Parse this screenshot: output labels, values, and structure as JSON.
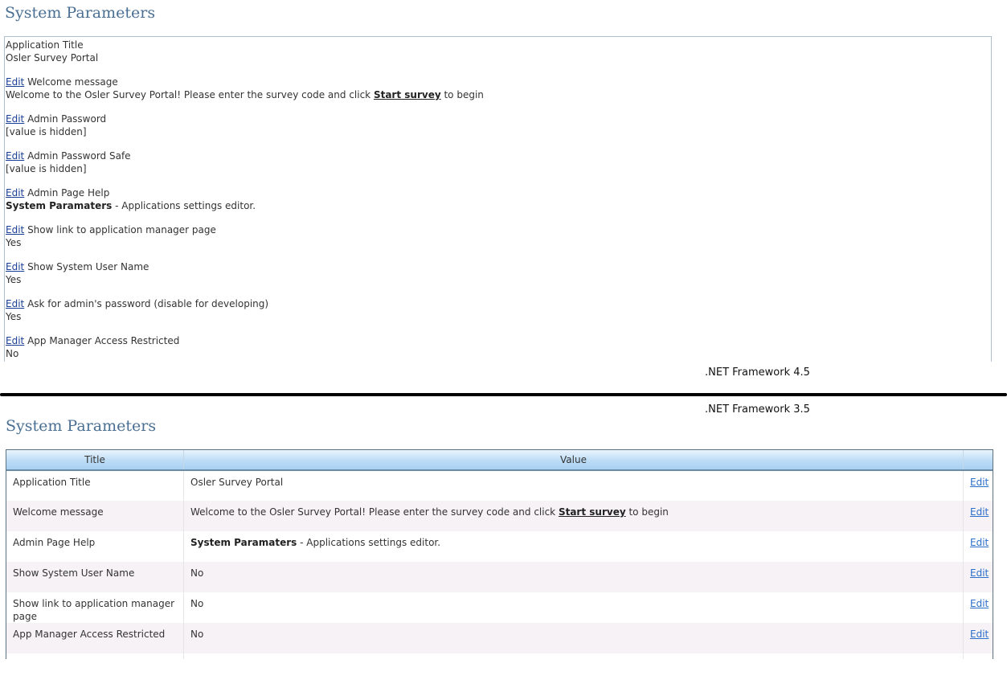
{
  "top": {
    "title": "System Parameters",
    "params": [
      {
        "edit": "",
        "name": "Application Title",
        "value": "Osler Survey Portal"
      },
      {
        "edit": "Edit",
        "name": " Welcome message",
        "value_pre": "Welcome to the Osler Survey Portal! Please enter the survey code and click ",
        "value_link": "Start survey",
        "value_post": " to begin"
      },
      {
        "edit": "Edit",
        "name": " Admin Password",
        "value": "[value is hidden]"
      },
      {
        "edit": "Edit",
        "name": " Admin Password Safe",
        "value": "[value is hidden]"
      },
      {
        "edit": "Edit",
        "name": " Admin Page Help",
        "value_bold": "System Paramaters",
        "value_rest": " - Applications settings editor."
      },
      {
        "edit": "Edit",
        "name": " Show link to application manager page",
        "value": "Yes"
      },
      {
        "edit": "Edit",
        "name": " Show System User Name",
        "value": "Yes"
      },
      {
        "edit": "Edit",
        "name": " Ask for admin's password (disable for developing)",
        "value": "Yes"
      },
      {
        "edit": "Edit",
        "name": " App Manager Access Restricted",
        "value": "No"
      }
    ]
  },
  "labels": {
    "fw45": ".NET Framework 4.5",
    "fw35": ".NET Framework 3.5"
  },
  "bottom": {
    "title": "System Parameters",
    "columns": {
      "title": "Title",
      "value": "Value",
      "edit": ""
    },
    "rows": [
      {
        "title": "Application Title",
        "value": "Osler Survey Portal",
        "edit": "Edit"
      },
      {
        "title": "Welcome message",
        "value_pre": "Welcome to the Osler Survey Portal! Please enter the survey code and click ",
        "value_link": "Start survey",
        "value_post": " to begin",
        "edit": "Edit"
      },
      {
        "title": "Admin Page Help",
        "value_bold": "System Paramaters",
        "value_rest": " - Applications settings editor.",
        "edit": "Edit"
      },
      {
        "title": "Show System User Name",
        "value": "No",
        "edit": "Edit"
      },
      {
        "title": "Show link to application manager page",
        "value": "No",
        "edit": "Edit"
      },
      {
        "title": "App Manager Access Restricted",
        "value": "No",
        "edit": "Edit"
      }
    ]
  },
  "colors": {
    "title": "#4a6f92",
    "link_top": "#1a3f96",
    "link_grid": "#2a6fc9",
    "alt_row": "#f6f2f6",
    "header_gradient": "#bcdcf6"
  }
}
